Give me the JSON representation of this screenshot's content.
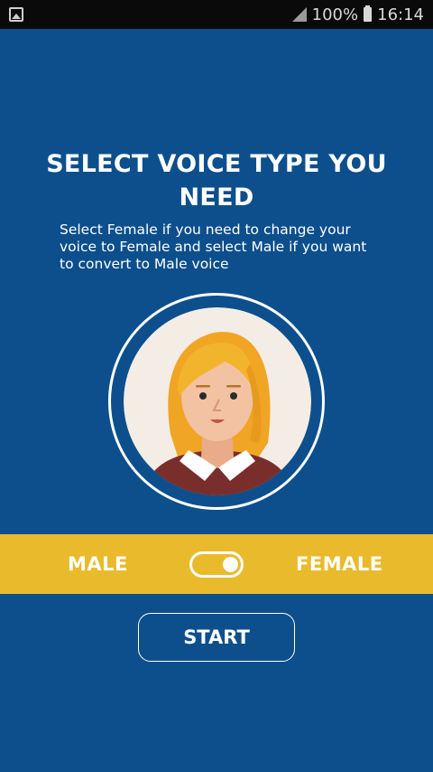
{
  "status_bar": {
    "battery_text": "100%",
    "time": "16:14",
    "icons": [
      "gallery-icon",
      "signal-icon",
      "battery-icon"
    ]
  },
  "main": {
    "title": "SELECT VOICE TYPE YOU NEED",
    "description": "Select Female if you need to change your voice to Female and select Male if you want to convert to Male voice"
  },
  "gender_selector": {
    "male_label": "MALE",
    "female_label": "FEMALE",
    "selected": "FEMALE"
  },
  "start_button": {
    "label": "START"
  },
  "colors": {
    "background": "#0d4f8c",
    "accent": "#e9bb2c",
    "text": "#ffffff"
  }
}
